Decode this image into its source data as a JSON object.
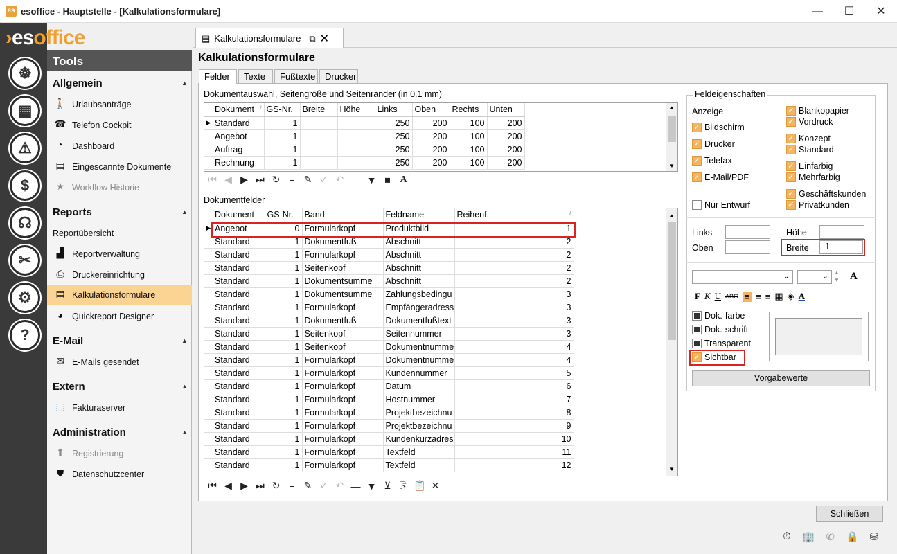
{
  "window": {
    "title": "esoffice - Hauptstelle - [Kalkulationsformulare]",
    "minimize": "—",
    "maximize": "☐",
    "close": "✕"
  },
  "brand": {
    "logo_a": "es",
    "logo_b": "office"
  },
  "sidebar": {
    "icons": [
      "steering-wheel-icon",
      "barcode-icon",
      "alarm-light-icon",
      "money-icon",
      "headset-icon",
      "tools-icon",
      "gears-icon",
      "help-icon"
    ],
    "header": "Tools",
    "sections": [
      {
        "title": "Allgemein",
        "items": [
          "Urlaubsanträge",
          "Telefon Cockpit",
          "Dashboard",
          "Eingescannte Dokumente",
          "Workflow Historie"
        ]
      },
      {
        "title": "Reports",
        "items": [
          "Reportübersicht",
          "Reportverwaltung",
          "Druckereinrichtung",
          "Kalkulationsformulare",
          "Quickreport Designer"
        ]
      },
      {
        "title": "E-Mail",
        "items": [
          "E-Mails gesendet"
        ]
      },
      {
        "title": "Extern",
        "items": [
          "Fakturaserver"
        ]
      },
      {
        "title": "Administration",
        "items": [
          "Registrierung",
          "Datenschutzcenter"
        ]
      }
    ]
  },
  "doc_tab": {
    "label": "Kalkulationsformulare"
  },
  "page": {
    "title": "Kalkulationsformulare",
    "tabs": [
      "Felder",
      "Texte",
      "Fußtexte",
      "Drucker"
    ]
  },
  "top_grid": {
    "caption": "Dokumentauswahl, Seitengröße und Seitenränder (in 0.1 mm)",
    "columns": [
      "Dokument",
      "GS-Nr.",
      "Breite",
      "Höhe",
      "Links",
      "Oben",
      "Rechts",
      "Unten"
    ],
    "sort_mark": "/",
    "rows": [
      [
        "Standard",
        "1",
        "",
        "",
        "250",
        "200",
        "100",
        "200"
      ],
      [
        "Angebot",
        "1",
        "",
        "",
        "250",
        "200",
        "100",
        "200"
      ],
      [
        "Auftrag",
        "1",
        "",
        "",
        "250",
        "200",
        "100",
        "200"
      ],
      [
        "Rechnung",
        "1",
        "",
        "",
        "250",
        "200",
        "100",
        "200"
      ]
    ]
  },
  "bottom_grid": {
    "caption": "Dokumentfelder",
    "columns": [
      "Dokument",
      "GS-Nr.",
      "Band",
      "Feldname",
      "Reihenf."
    ],
    "sort_mark": "/",
    "rows": [
      [
        "Angebot",
        "0",
        "Formularkopf",
        "Produktbild",
        "1"
      ],
      [
        "Standard",
        "1",
        "Dokumentfuß",
        "Abschnitt",
        "2"
      ],
      [
        "Standard",
        "1",
        "Formularkopf",
        "Abschnitt",
        "2"
      ],
      [
        "Standard",
        "1",
        "Seitenkopf",
        "Abschnitt",
        "2"
      ],
      [
        "Standard",
        "1",
        "Dokumentsumme",
        "Abschnitt",
        "2"
      ],
      [
        "Standard",
        "1",
        "Dokumentsumme",
        "Zahlungsbedingu",
        "3"
      ],
      [
        "Standard",
        "1",
        "Formularkopf",
        "Empfängeradress",
        "3"
      ],
      [
        "Standard",
        "1",
        "Dokumentfuß",
        "Dokumentfußtext",
        "3"
      ],
      [
        "Standard",
        "1",
        "Seitenkopf",
        "Seitennummer",
        "3"
      ],
      [
        "Standard",
        "1",
        "Seitenkopf",
        "Dokumentnumme",
        "4"
      ],
      [
        "Standard",
        "1",
        "Formularkopf",
        "Dokumentnumme",
        "4"
      ],
      [
        "Standard",
        "1",
        "Formularkopf",
        "Kundennummer",
        "5"
      ],
      [
        "Standard",
        "1",
        "Formularkopf",
        "Datum",
        "6"
      ],
      [
        "Standard",
        "1",
        "Formularkopf",
        "Hostnummer",
        "7"
      ],
      [
        "Standard",
        "1",
        "Formularkopf",
        "Projektbezeichnu",
        "8"
      ],
      [
        "Standard",
        "1",
        "Formularkopf",
        "Projektbezeichnu",
        "9"
      ],
      [
        "Standard",
        "1",
        "Formularkopf",
        "Kundenkurzadres",
        "10"
      ],
      [
        "Standard",
        "1",
        "Formularkopf",
        "Textfeld",
        "11"
      ],
      [
        "Standard",
        "1",
        "Formularkopf",
        "Textfeld",
        "12"
      ]
    ]
  },
  "props": {
    "title": "Feldeigenschaften",
    "anzeige": "Anzeige",
    "left_checks": [
      {
        "label": "Bildschirm",
        "checked": true
      },
      {
        "label": "Drucker",
        "checked": true
      },
      {
        "label": "Telefax",
        "checked": true
      },
      {
        "label": "E-Mail/PDF",
        "checked": true
      },
      {
        "label": "Nur Entwurf",
        "checked": false
      }
    ],
    "right_checks": [
      {
        "label": "Blankopapier",
        "checked": true
      },
      {
        "label": "Vordruck",
        "checked": true
      },
      {
        "label": "Konzept",
        "checked": true
      },
      {
        "label": "Standard",
        "checked": true
      },
      {
        "label": "Einfarbig",
        "checked": true
      },
      {
        "label": "Mehrfarbig",
        "checked": true
      },
      {
        "label": "Geschäftskunden",
        "checked": true
      },
      {
        "label": "Privatkunden",
        "checked": true
      }
    ],
    "links": "Links",
    "oben": "Oben",
    "hoehe": "Höhe",
    "breite": "Breite",
    "breite_value": "-1",
    "style_checks": [
      {
        "label": "Dok.-farbe"
      },
      {
        "label": "Dok.-schrift"
      },
      {
        "label": "Transparent"
      }
    ],
    "sichtbar": "Sichtbar",
    "defaults_button": "Vorgabewerte"
  },
  "close_button": "Schließen",
  "colors": {
    "accent": "#f3b561",
    "selected_nav": "#fbd493",
    "highlight": "#dd2222"
  }
}
